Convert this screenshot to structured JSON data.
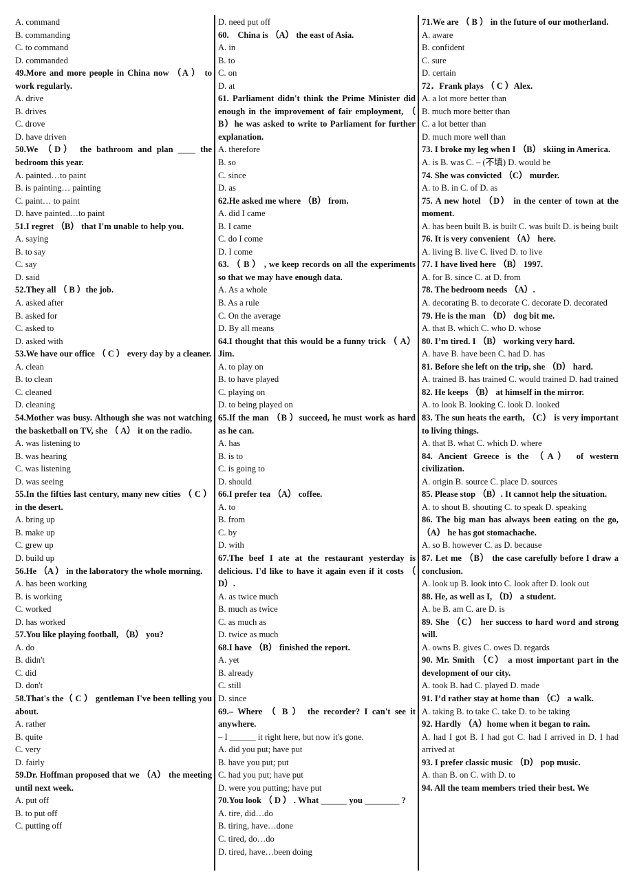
{
  "columns": [
    {
      "items": [
        {
          "type": "opt",
          "text": "A. command"
        },
        {
          "type": "opt",
          "text": "B. commanding"
        },
        {
          "type": "opt",
          "text": "C. to command"
        },
        {
          "type": "opt",
          "text": "D. commanded"
        },
        {
          "type": "q",
          "text": "49.More and more people in China now （A ） to work regularly."
        },
        {
          "type": "opt",
          "text": "A. drive"
        },
        {
          "type": "opt",
          "text": "B. drives"
        },
        {
          "type": "opt",
          "text": "C. drove"
        },
        {
          "type": "opt",
          "text": "D. have driven"
        },
        {
          "type": "q",
          "text": "50.We （D） the bathroom and plan ____ the bedroom this year."
        },
        {
          "type": "opt",
          "text": "A. painted…to paint"
        },
        {
          "type": "opt",
          "text": "B. is painting… painting"
        },
        {
          "type": "opt",
          "text": "C. paint… to paint"
        },
        {
          "type": "opt",
          "text": "D. have painted…to paint"
        },
        {
          "type": "q",
          "text": "51.I regret （B） that I'm unable to help you."
        },
        {
          "type": "opt",
          "text": "A. saying"
        },
        {
          "type": "opt",
          "text": "B. to say"
        },
        {
          "type": "opt",
          "text": "C. say"
        },
        {
          "type": "opt",
          "text": "D. said"
        },
        {
          "type": "q",
          "text": "52.They all （ B ）the job."
        },
        {
          "type": "opt",
          "text": "A. asked after"
        },
        {
          "type": "opt",
          "text": "B. asked for"
        },
        {
          "type": "opt",
          "text": "C. asked to"
        },
        {
          "type": "opt",
          "text": "D. asked with"
        },
        {
          "type": "q",
          "text": "53.We have our office （ C ） every day by a cleaner."
        },
        {
          "type": "opt",
          "text": "A. clean"
        },
        {
          "type": "opt",
          "text": "B. to clean"
        },
        {
          "type": "opt",
          "text": "C. cleaned"
        },
        {
          "type": "opt",
          "text": "D. cleaning"
        },
        {
          "type": "q",
          "text": "54.Mother was busy. Although she was not watching the basketball on TV, she （ A） it on the radio."
        },
        {
          "type": "opt",
          "text": "A. was listening to"
        },
        {
          "type": "opt",
          "text": "B. was hearing"
        },
        {
          "type": "opt",
          "text": "C. was listening"
        },
        {
          "type": "opt",
          "text": "D. was seeing"
        },
        {
          "type": "q",
          "text": "55.In the fifties last century, many new cities （ C ） in the desert."
        },
        {
          "type": "opt",
          "text": "A. bring up"
        },
        {
          "type": "opt",
          "text": "B. make up"
        },
        {
          "type": "opt",
          "text": "C. grew up"
        },
        {
          "type": "opt",
          "text": "D. build up"
        },
        {
          "type": "q",
          "text": "56.He （A ） in the laboratory the whole morning."
        },
        {
          "type": "opt",
          "text": "A. has been working"
        },
        {
          "type": "opt",
          "text": "B. is working"
        },
        {
          "type": "opt",
          "text": "C. worked"
        },
        {
          "type": "opt",
          "text": "D. has worked"
        },
        {
          "type": "q",
          "text": "57.You like playing football, （B） you?"
        },
        {
          "type": "opt",
          "text": "A. do"
        },
        {
          "type": "opt",
          "text": "B. didn't"
        },
        {
          "type": "opt",
          "text": "C. did"
        },
        {
          "type": "opt",
          "text": "D. don't"
        },
        {
          "type": "q",
          "text": "58.That's the（ C ） gentleman I've been telling you about."
        },
        {
          "type": "opt",
          "text": "A. rather"
        },
        {
          "type": "opt",
          "text": "B. quite"
        },
        {
          "type": "opt",
          "text": "C. very"
        },
        {
          "type": "opt",
          "text": "D. fairly"
        },
        {
          "type": "q",
          "text": "59.Dr. Hoffman proposed that we （A） the meeting until next week."
        },
        {
          "type": "opt",
          "text": "A. put off"
        },
        {
          "type": "opt",
          "text": "B. to put off"
        },
        {
          "type": "opt",
          "text": "C. putting off"
        }
      ]
    },
    {
      "items": [
        {
          "type": "opt",
          "text": "D. need put off"
        },
        {
          "type": "q",
          "text": "60.　China is （A） the east of Asia."
        },
        {
          "type": "opt",
          "text": "A. in"
        },
        {
          "type": "opt",
          "text": "B. to"
        },
        {
          "type": "opt",
          "text": "C. on"
        },
        {
          "type": "opt",
          "text": "D. at"
        },
        {
          "type": "q",
          "text": "61. Parliament didn't think the Prime Minister did enough in the improvement of fair employment, （ B）he was asked to write to Parliament for further explanation."
        },
        {
          "type": "opt",
          "text": "A. therefore"
        },
        {
          "type": "opt",
          "text": "B. so"
        },
        {
          "type": "opt",
          "text": "C. since"
        },
        {
          "type": "opt",
          "text": "D. as"
        },
        {
          "type": "q",
          "text": "62.He asked me where （B） from."
        },
        {
          "type": "opt",
          "text": "A. did I came"
        },
        {
          "type": "opt",
          "text": "B. I came"
        },
        {
          "type": "opt",
          "text": "C. do I come"
        },
        {
          "type": "opt",
          "text": "D. I come"
        },
        {
          "type": "q",
          "text": "63. （ B ） , we keep records on all the experiments so that we may have enough data."
        },
        {
          "type": "opt",
          "text": "A. As a whole"
        },
        {
          "type": "opt",
          "text": "B. As a rule"
        },
        {
          "type": "opt",
          "text": "C. On the average"
        },
        {
          "type": "opt",
          "text": "D. By all means"
        },
        {
          "type": "q",
          "text": "64.I thought that this would be a funny trick （ A）Jim."
        },
        {
          "type": "opt",
          "text": "A. to play on"
        },
        {
          "type": "opt",
          "text": "B. to have played"
        },
        {
          "type": "opt",
          "text": "C. playing on"
        },
        {
          "type": "opt",
          "text": "D. to being played on"
        },
        {
          "type": "q",
          "text": "65.If the man （B ）succeed, he must work as hard as he can."
        },
        {
          "type": "opt",
          "text": "A. has"
        },
        {
          "type": "opt",
          "text": "B. is to"
        },
        {
          "type": "opt",
          "text": "C. is going to"
        },
        {
          "type": "opt",
          "text": "D. should"
        },
        {
          "type": "q",
          "text": "66.I prefer tea （A） coffee."
        },
        {
          "type": "opt",
          "text": "A. to"
        },
        {
          "type": "opt",
          "text": "B. from"
        },
        {
          "type": "opt",
          "text": "C. by"
        },
        {
          "type": "opt",
          "text": "D. with"
        },
        {
          "type": "q",
          "text": "67.The beef I ate at the restaurant yesterday is delicious. I'd like to have it again even if it costs （ D）."
        },
        {
          "type": "opt",
          "text": "A. as twice much"
        },
        {
          "type": "opt",
          "text": "B. much as twice"
        },
        {
          "type": "opt",
          "text": "C. as much as"
        },
        {
          "type": "opt",
          "text": "D. twice as much"
        },
        {
          "type": "q",
          "text": "68.I have （B） finished the report."
        },
        {
          "type": "opt",
          "text": "A. yet"
        },
        {
          "type": "opt",
          "text": "B. already"
        },
        {
          "type": "opt",
          "text": "C. still"
        },
        {
          "type": "opt",
          "text": "D. since"
        },
        {
          "type": "q",
          "text": "69.– Where （ B ） the recorder? I can't see it anywhere."
        },
        {
          "type": "opt",
          "text": "– I ______ it right here, but now it's gone."
        },
        {
          "type": "opt",
          "text": "A. did you put; have put"
        },
        {
          "type": "opt",
          "text": "B. have you put; put"
        },
        {
          "type": "opt",
          "text": "C. had you put; have put"
        },
        {
          "type": "opt",
          "text": "D. were you putting; have put"
        },
        {
          "type": "q",
          "text": "70.You look （ D ） . What ______ you ________ ?"
        },
        {
          "type": "opt",
          "text": "A. tire, did…do"
        },
        {
          "type": "opt",
          "text": "B. tiring, have…done"
        },
        {
          "type": "opt",
          "text": "C. tired, do…do"
        },
        {
          "type": "opt",
          "text": "D. tired, have…been doing"
        }
      ]
    },
    {
      "items": [
        {
          "type": "q",
          "text": "71.We are （ B ） in the future of our motherland."
        },
        {
          "type": "opt",
          "text": "A. aware"
        },
        {
          "type": "opt",
          "text": "B. confident"
        },
        {
          "type": "opt",
          "text": "C. sure"
        },
        {
          "type": "opt",
          "text": "D. certain"
        },
        {
          "type": "q",
          "text": "72．Frank plays （ C ）Alex."
        },
        {
          "type": "opt",
          "text": "A. a lot more better than"
        },
        {
          "type": "opt",
          "text": "B. much more better than"
        },
        {
          "type": "opt",
          "text": "C. a lot better than"
        },
        {
          "type": "opt",
          "text": "D. much more well than"
        },
        {
          "type": "q",
          "text": "73. I broke my leg when I （B） skiing in America."
        },
        {
          "type": "opt",
          "text": "A. is B. was C. – (不填) D. would be"
        },
        {
          "type": "q",
          "text": "74. She was convicted （C） murder."
        },
        {
          "type": "opt",
          "text": "A. to B. in C. of D. as"
        },
        {
          "type": "q",
          "text": "75. A new hotel （D） in the center of town at the moment."
        },
        {
          "type": "opt",
          "text": "A. has been built B. is built C. was built D. is being built"
        },
        {
          "type": "q",
          "text": "76. It is very convenient （A） here."
        },
        {
          "type": "opt",
          "text": "A. living B. live C. lived D. to live"
        },
        {
          "type": "q",
          "text": "77. I have lived here （B） 1997."
        },
        {
          "type": "opt",
          "text": "A. for B. since C. at D. from"
        },
        {
          "type": "q",
          "text": "78. The bedroom needs （A）."
        },
        {
          "type": "opt",
          "text": "A. decorating B. to decorate C. decorate D. decorated"
        },
        {
          "type": "q",
          "text": "79. He is the man （D） dog bit me."
        },
        {
          "type": "opt",
          "text": "A. that B. which C. who D. whose"
        },
        {
          "type": "q",
          "text": "80. I’m tired. I （B） working very hard."
        },
        {
          "type": "opt",
          "text": "A. have B. have been C. had D. has"
        },
        {
          "type": "q",
          "text": "81. Before she left on the trip, she （D） hard."
        },
        {
          "type": "opt",
          "text": "A. trained B. has trained C. would trained D. had trained"
        },
        {
          "type": "q",
          "text": "82. He keeps （B） at himself in the mirror."
        },
        {
          "type": "opt",
          "text": "A. to look B. looking C. look D. looked"
        },
        {
          "type": "q",
          "text": "83. The sun heats the earth, （C） is very important to living things."
        },
        {
          "type": "opt",
          "text": "A. that B. what C. which D. where"
        },
        {
          "type": "q",
          "text": "84. Ancient Greece is the （A） of western civilization."
        },
        {
          "type": "opt",
          "text": "A. origin B. source C. place D. sources"
        },
        {
          "type": "q",
          "text": "85. Please stop （B）. It cannot help the situation."
        },
        {
          "type": "opt",
          "text": "A. to shout B. shouting C. to speak D. speaking"
        },
        {
          "type": "q",
          "text": "86. The big man has always been eating on the go, （A） he has got stomachache."
        },
        {
          "type": "opt",
          "text": "A. so B. however C. as D. because"
        },
        {
          "type": "q",
          "text": "87. Let me （B） the case carefully before I draw a conclusion."
        },
        {
          "type": "opt",
          "text": "A. look up B. look into C. look after D. look out"
        },
        {
          "type": "q",
          "text": "88. He, as well as I, （D） a student."
        },
        {
          "type": "opt",
          "text": "A. be B. am C. are D. is"
        },
        {
          "type": "q",
          "text": "89. She （C） her success to hard word and strong will."
        },
        {
          "type": "opt",
          "text": "A. owns B. gives C. owes D. regards"
        },
        {
          "type": "q",
          "text": "90. Mr. Smith （C） a most important part in the development of our city."
        },
        {
          "type": "opt",
          "text": "A. took B. had C. played D. made"
        },
        {
          "type": "q",
          "text": "91. I’d rather stay at home than （C） a walk."
        },
        {
          "type": "opt",
          "text": "A. taking B. to take C. take D. to be taking"
        },
        {
          "type": "q",
          "text": "92. Hardly （A）home when it began to rain."
        },
        {
          "type": "opt",
          "text": "A. had I got B. I had got C. had I arrived in D. I had arrived at"
        },
        {
          "type": "q",
          "text": "93. I prefer classic music （D） pop music."
        },
        {
          "type": "opt",
          "text": "A. than B. on C. with D. to"
        },
        {
          "type": "q",
          "text": "94. All the team members tried their best. We"
        }
      ]
    }
  ]
}
